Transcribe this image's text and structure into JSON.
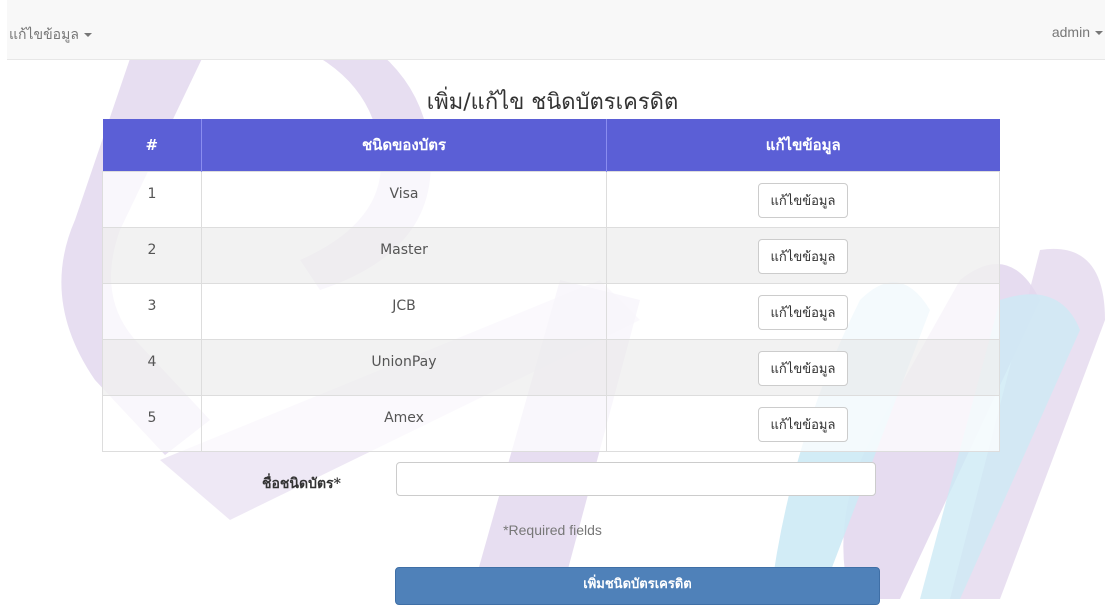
{
  "navbar": {
    "left_menu_label": "แก้ไขข้อมูล",
    "right_menu_label": "admin"
  },
  "page": {
    "title": "เพิ่ม/แก้ไข ชนิดบัตรเครดิต"
  },
  "table": {
    "headers": [
      "#",
      "ชนิดของบัตร",
      "แก้ไขข้อมูล"
    ],
    "rows": [
      {
        "num": "1",
        "name": "Visa",
        "action": "แก้ไขข้อมูล"
      },
      {
        "num": "2",
        "name": "Master",
        "action": "แก้ไขข้อมูล"
      },
      {
        "num": "3",
        "name": "JCB",
        "action": "แก้ไขข้อมูล"
      },
      {
        "num": "4",
        "name": "UnionPay",
        "action": "แก้ไขข้อมูล"
      },
      {
        "num": "5",
        "name": "Amex",
        "action": "แก้ไขข้อมูล"
      }
    ]
  },
  "form": {
    "card_name_label": "ชื่อชนิดบัตร*",
    "card_name_value": "",
    "required_note": "*Required fields",
    "submit_label": "เพิ่มชนิดบัตรเครดิต"
  },
  "colors": {
    "header_bg": "#5b5fd6",
    "submit_bg": "#4f81b9",
    "watermark_purple": "#d9cde8",
    "watermark_cyan": "#bfe6f3"
  }
}
